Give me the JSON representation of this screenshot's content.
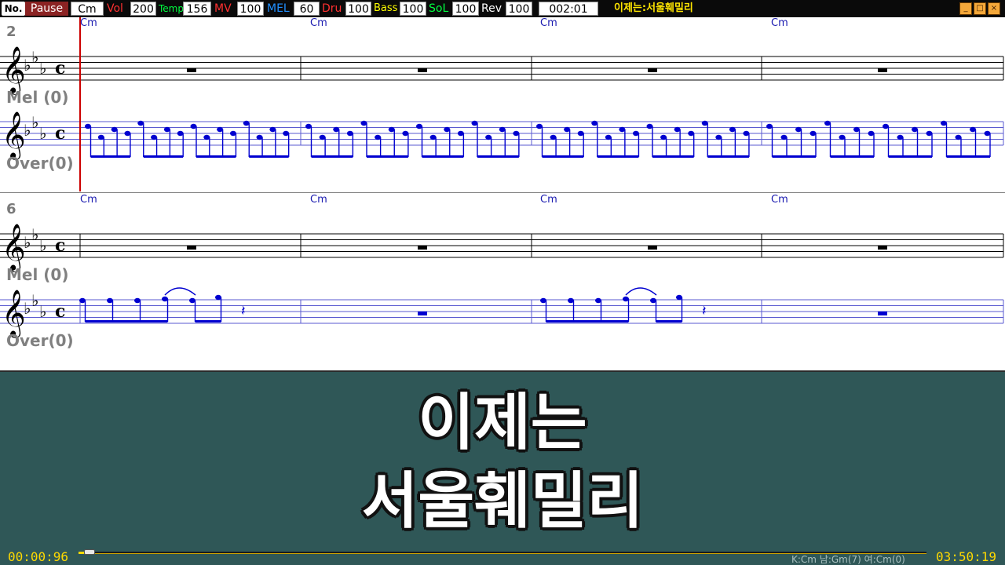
{
  "toolbar": {
    "no_label": "No.",
    "state": "Pause",
    "key": "Cm",
    "controls": [
      {
        "label": "Vol",
        "value": "200",
        "color": "#ff3030"
      },
      {
        "label": "Temp",
        "value": "156",
        "color": "#00ff40"
      },
      {
        "label": "MV",
        "value": "100",
        "color": "#ff3030"
      },
      {
        "label": "MEL",
        "value": "60",
        "color": "#2090ff"
      },
      {
        "label": "Dru",
        "value": "100",
        "color": "#ff3030"
      },
      {
        "label": "Bass",
        "value": "100",
        "color": "#ffff00"
      },
      {
        "label": "SoL",
        "value": "100",
        "color": "#00ff40"
      },
      {
        "label": "Rev",
        "value": "100",
        "color": "#ffffff"
      }
    ],
    "time": "002:01",
    "song_title": "이제는:서울훼밀리"
  },
  "score": {
    "systems": [
      {
        "measure_number": "2",
        "chords": [
          "Cm",
          "Cm",
          "Cm",
          "Cm"
        ],
        "track_labels": [
          "Mel (0)",
          "Over(0)"
        ]
      },
      {
        "measure_number": "6",
        "chords": [
          "Cm",
          "Cm",
          "Cm",
          "Cm"
        ],
        "track_labels": [
          "Mel (0)",
          "Over(0)"
        ]
      }
    ]
  },
  "lyrics": {
    "line1": "이제는",
    "line2": "서울훼밀리"
  },
  "bottom": {
    "elapsed": "00:00:96",
    "total": "03:50:19",
    "key_info": "K:Cm 남:Gm(7) 여:Cm(0)",
    "progress": 0.01
  },
  "colors": {
    "note": "#0000d0",
    "cursor": "#cc0000",
    "lyrics_bg": "#2f5757",
    "time_text": "#ffd900"
  }
}
